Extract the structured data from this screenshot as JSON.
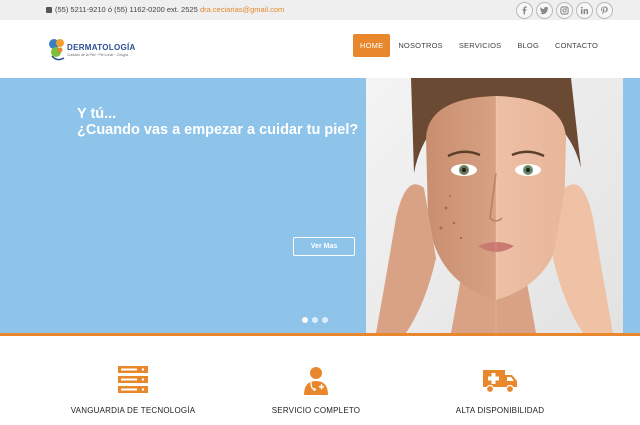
{
  "topbar": {
    "phone": "(55) 5211-9210 ó (55) 1162-0200 ext. 2525",
    "email": "dra.ceciarias@gmail.com",
    "socials": [
      "facebook-icon",
      "twitter-icon",
      "instagram-icon",
      "linkedin-icon",
      "pinterest-icon"
    ]
  },
  "header": {
    "logo_text": "DERMATOLOGÍA",
    "logo_sub": "Cuidado de la Piel · Pie Lunar · Cirugía",
    "nav": [
      "HOME",
      "NOSOTROS",
      "SERVICIOS",
      "BLOG",
      "CONTACTO"
    ],
    "active_nav": "HOME"
  },
  "hero": {
    "line1": "Y tú...",
    "line2": "¿Cuando vas a empezar a cuidar tu piel?",
    "button": "Ver Mas",
    "slide_count": 3,
    "active_slide": 1
  },
  "features": [
    {
      "icon": "server-stack-icon",
      "label": "VANGUARDIA DE TECNOLOGÍA"
    },
    {
      "icon": "doctor-icon",
      "label": "SERVICIO COMPLETO"
    },
    {
      "icon": "ambulance-icon",
      "label": "ALTA DISPONIBILIDAD"
    }
  ],
  "colors": {
    "accent": "#e8872b",
    "hero_bg": "#8ec3ea",
    "logo_blue": "#2a4f8f"
  }
}
